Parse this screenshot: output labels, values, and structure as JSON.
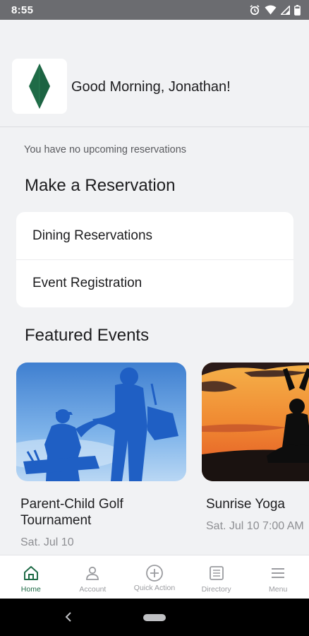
{
  "status_bar": {
    "time": "8:55"
  },
  "header": {
    "greeting": "Good Morning, Jonathan!"
  },
  "reservations": {
    "empty_message": "You have no upcoming reservations",
    "section_title": "Make a Reservation",
    "options": [
      {
        "label": "Dining Reservations"
      },
      {
        "label": "Event Registration"
      }
    ]
  },
  "featured": {
    "section_title": "Featured Events",
    "events": [
      {
        "title": "Parent-Child Golf Tournament",
        "date": "Sat. Jul 10"
      },
      {
        "title": "Sunrise Yoga",
        "date": "Sat. Jul 10 7:00 AM"
      }
    ]
  },
  "bottom_nav": [
    {
      "label": "Home",
      "icon": "home-icon",
      "active": true
    },
    {
      "label": "Account",
      "icon": "person-icon",
      "active": false
    },
    {
      "label": "Quick Action",
      "icon": "plus-circle-icon",
      "active": false
    },
    {
      "label": "Directory",
      "icon": "directory-icon",
      "active": false
    },
    {
      "label": "Menu",
      "icon": "hamburger-menu-icon",
      "active": false
    }
  ],
  "colors": {
    "brand_green": "#1f6b47",
    "background": "#f1f2f4",
    "status_bar": "#6b6c70"
  }
}
